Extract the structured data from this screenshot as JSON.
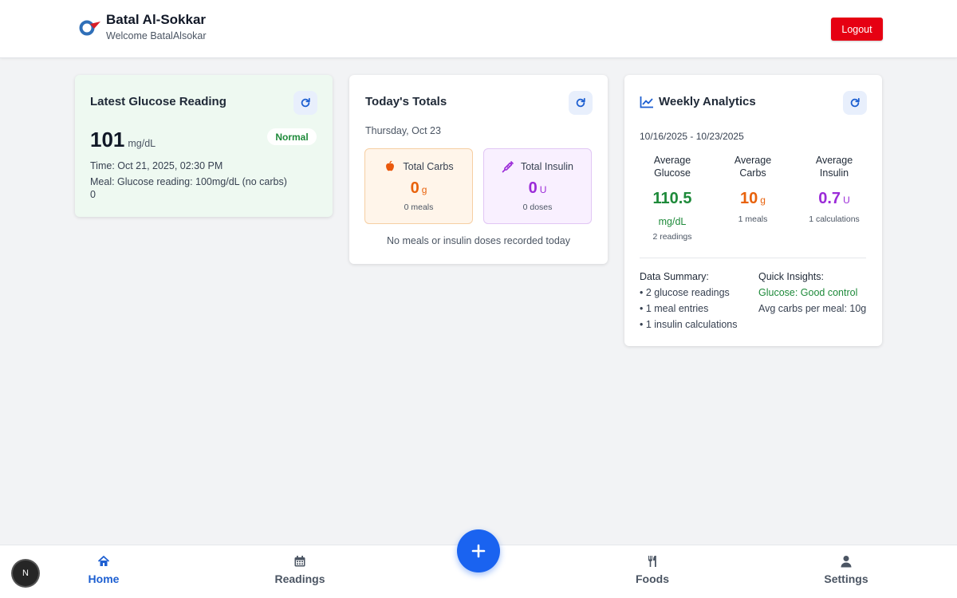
{
  "header": {
    "app_title": "Batal Al-Sokkar",
    "welcome": "Welcome BatalAlsokar",
    "logout_label": "Logout"
  },
  "glucose_card": {
    "title": "Latest Glucose Reading",
    "value": "101",
    "unit": "mg/dL",
    "status": "Normal",
    "time": "Time: Oct 21, 2025, 02:30 PM",
    "meal": "Meal: Glucose reading: 100mg/dL (no carbs)",
    "extra": "0"
  },
  "today_card": {
    "title": "Today's Totals",
    "date": "Thursday, Oct 23",
    "carbs": {
      "label": "Total Carbs",
      "value": "0",
      "unit": "g",
      "sub": "0 meals"
    },
    "insulin": {
      "label": "Total Insulin",
      "value": "0",
      "unit": "U",
      "sub": "0 doses"
    },
    "empty_message": "No meals or insulin doses recorded today"
  },
  "weekly_card": {
    "title": "Weekly Analytics",
    "range": "10/16/2025 - 10/23/2025",
    "glucose": {
      "label_line1": "Average",
      "label_line2": "Glucose",
      "value": "110.5",
      "unit": "mg/dL",
      "sub": "2 readings"
    },
    "carbs": {
      "label_line1": "Average",
      "label_line2": "Carbs",
      "value": "10",
      "unit": "g",
      "sub": "1 meals"
    },
    "insulin": {
      "label_line1": "Average",
      "label_line2": "Insulin",
      "value": "0.7",
      "unit": "U",
      "sub": "1 calculations"
    },
    "summary": {
      "title": "Data Summary:",
      "items": [
        "• 2 glucose readings",
        "• 1 meal entries",
        "• 1 insulin calculations"
      ]
    },
    "insights": {
      "title": "Quick Insights:",
      "glucose": "Glucose: Good control",
      "carbs": "Avg carbs per meal: 10g"
    }
  },
  "nav": {
    "items": [
      {
        "label": "Home",
        "icon": "home-icon",
        "active": true
      },
      {
        "label": "Readings",
        "icon": "calendar-icon",
        "active": false
      },
      {
        "label": "Foods",
        "icon": "utensils-icon",
        "active": false
      },
      {
        "label": "Settings",
        "icon": "user-icon",
        "active": false
      }
    ],
    "add_icon": "plus-icon",
    "dev_badge": "N"
  },
  "colors": {
    "accent": "#1a63f0",
    "logout": "#e60012",
    "success": "#1e8a3a",
    "carbs": "#e8620c",
    "insulin": "#9b2bd8",
    "glucose_card_bg": "#eef9f1"
  }
}
